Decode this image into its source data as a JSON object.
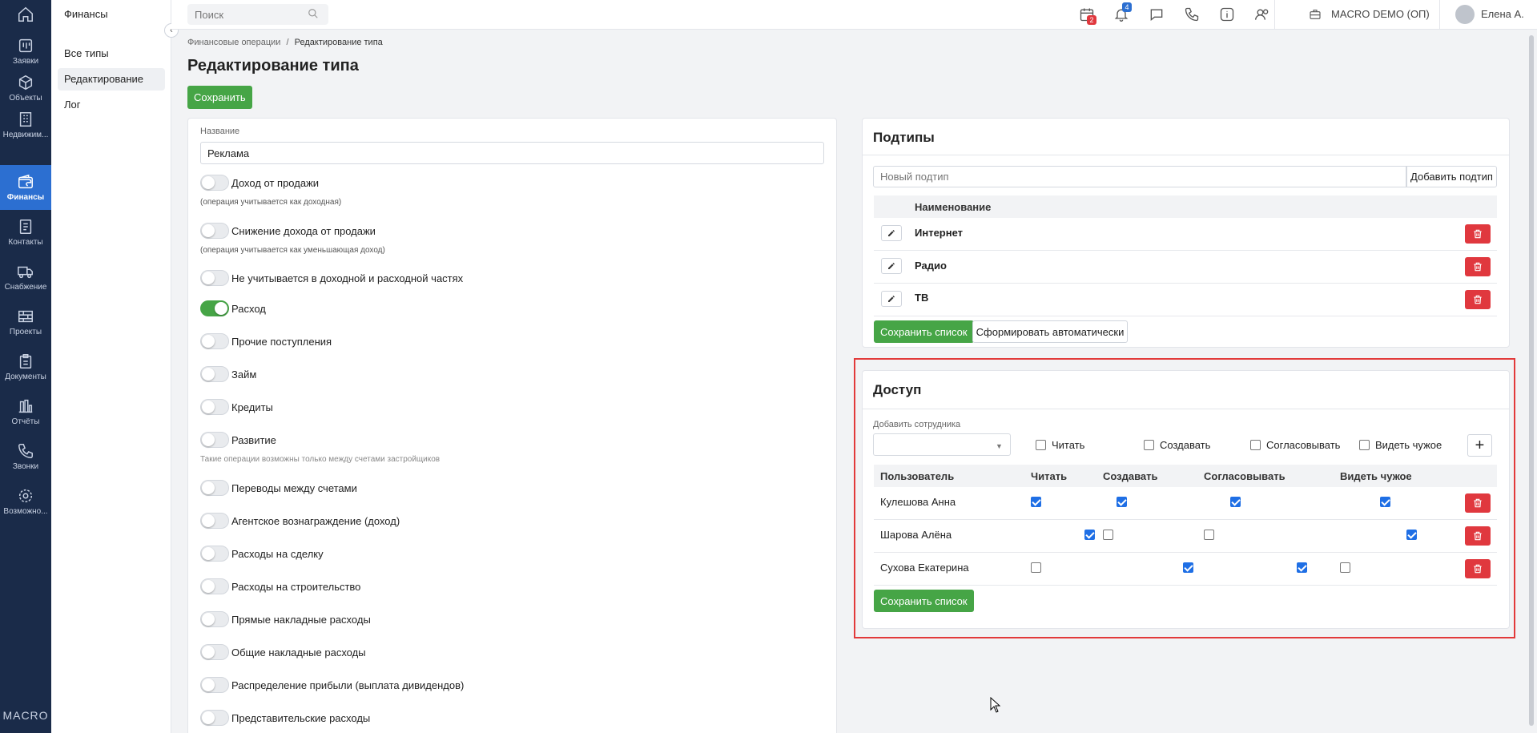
{
  "nav": {
    "items": [
      {
        "label": "Заявки",
        "icon": "requests-icon"
      },
      {
        "label": "Объекты",
        "icon": "cube-icon"
      },
      {
        "label": "Недвижим...",
        "icon": "building-icon"
      },
      {
        "label": "Финансы",
        "icon": "wallet-icon",
        "active": true
      },
      {
        "label": "Контакты",
        "icon": "contacts-icon"
      },
      {
        "label": "Снабжение",
        "icon": "truck-icon"
      },
      {
        "label": "Проекты",
        "icon": "bricks-icon"
      },
      {
        "label": "Документы",
        "icon": "clipboard-icon"
      },
      {
        "label": "Отчёты",
        "icon": "bar-chart-icon"
      },
      {
        "label": "Звонки",
        "icon": "phone-icon"
      },
      {
        "label": "Возможно...",
        "icon": "gear-icon"
      }
    ],
    "brand": "MACRO"
  },
  "sidebar": {
    "title": "Финансы",
    "items": [
      {
        "label": "Все типы"
      },
      {
        "label": "Редактирование",
        "active": true
      },
      {
        "label": "Лог"
      }
    ]
  },
  "topbar": {
    "search_placeholder": "Поиск",
    "calendar_badge": "2",
    "bell_badge": "4",
    "company": "MACRO DEMO (ОП)",
    "user": "Елена А."
  },
  "breadcrumb": {
    "parent": "Финансовые операции",
    "separator": "/",
    "current": "Редактирование типа"
  },
  "page": {
    "title": "Редактирование типа",
    "save_label": "Сохранить"
  },
  "form": {
    "name_label": "Название",
    "name_value": "Реклама",
    "toggles": [
      {
        "label": "Доход от продажи",
        "hint": "(операция учитывается как доходная)",
        "on": false
      },
      {
        "label": "Снижение дохода от продажи",
        "hint": "(операция учитывается как уменьшающая доход)",
        "on": false
      },
      {
        "label": "Не учитывается в доходной и расходной частях",
        "on": false
      },
      {
        "label": "Расход",
        "on": true
      },
      {
        "label": "Прочие поступления",
        "on": false
      },
      {
        "label": "Займ",
        "on": false
      },
      {
        "label": "Кредиты",
        "on": false
      },
      {
        "label": "Развитие",
        "hint": "Такие операции возможны только между счетами застройщиков",
        "on": false
      },
      {
        "label": "Переводы между счетами",
        "on": false
      },
      {
        "label": "Агентское вознаграждение (доход)",
        "on": false
      },
      {
        "label": "Расходы на сделку",
        "on": false
      },
      {
        "label": "Расходы на строительство",
        "on": false
      },
      {
        "label": "Прямые накладные расходы",
        "on": false
      },
      {
        "label": "Общие накладные расходы",
        "on": false
      },
      {
        "label": "Распределение прибыли (выплата дивидендов)",
        "on": false
      },
      {
        "label": "Представительские расходы",
        "on": false
      }
    ]
  },
  "subtypes": {
    "title": "Подтипы",
    "new_placeholder": "Новый подтип",
    "add_label": "Добавить подтип",
    "column": "Наименование",
    "rows": [
      "Интернет",
      "Радио",
      "ТВ"
    ],
    "save_label": "Сохранить список",
    "auto_label": "Сформировать автоматически"
  },
  "access": {
    "title": "Доступ",
    "add_employee_label": "Добавить сотрудника",
    "perm_labels": [
      "Читать",
      "Создавать",
      "Согласовывать",
      "Видеть чужое"
    ],
    "columns": [
      "Пользователь",
      "Читать",
      "Создавать",
      "Согласовывать",
      "Видеть чужое"
    ],
    "rows": [
      {
        "user": "Кулешова Анна",
        "perms": [
          true,
          true,
          true,
          true
        ]
      },
      {
        "user": "Шарова Алёна",
        "perms": [
          true,
          false,
          false,
          true
        ]
      },
      {
        "user": "Сухова Екатерина",
        "perms": [
          false,
          true,
          true,
          false
        ]
      }
    ],
    "save_label": "Сохранить список",
    "highlight_color": "#e23a3a"
  },
  "colors": {
    "nav_bg": "#1a2b49",
    "nav_active": "#2c6fd1",
    "green": "#46a546",
    "danger": "#e0383e",
    "check": "#1f6fe5"
  }
}
